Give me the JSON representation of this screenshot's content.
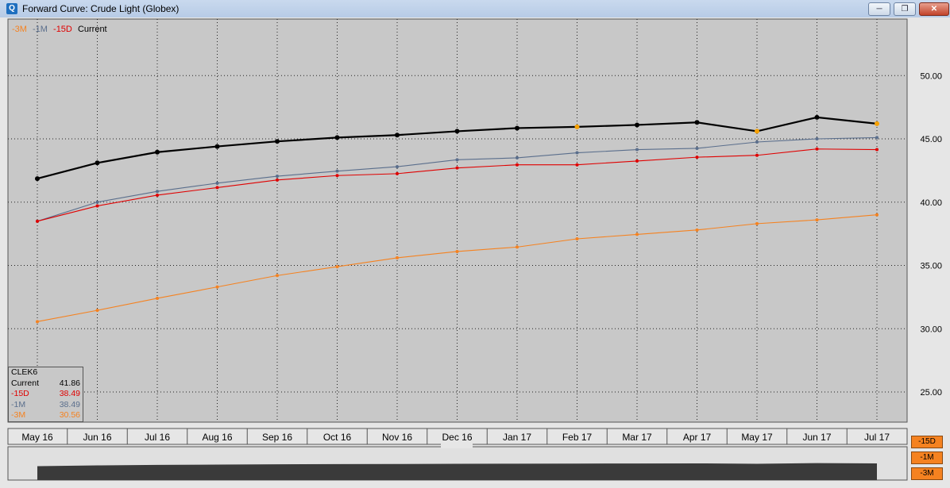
{
  "window": {
    "title": "Forward Curve: Crude Light (Globex)",
    "icon": "q-app-icon"
  },
  "window_buttons": [
    "minimize",
    "restore",
    "close"
  ],
  "legend": [
    {
      "label": "-3M",
      "color": "#f58220"
    },
    {
      "label": "-1M",
      "color": "#5a6e8c"
    },
    {
      "label": "-15D",
      "color": "#e00000"
    },
    {
      "label": "Current",
      "color": "#000000"
    }
  ],
  "info_box": {
    "title": "CLEK6",
    "rows": [
      {
        "label": "Current",
        "value": "41.86",
        "color": "#000000"
      },
      {
        "label": "-15D",
        "value": "38.49",
        "color": "#e00000"
      },
      {
        "label": "-1M",
        "value": "38.49",
        "color": "#5a6e8c"
      },
      {
        "label": "-3M",
        "value": "30.56",
        "color": "#f58220"
      }
    ]
  },
  "side_buttons": [
    "-15D",
    "-1M",
    "-3M"
  ],
  "chart_data": {
    "type": "line",
    "categories": [
      "May 16",
      "Jun 16",
      "Jul 16",
      "Aug 16",
      "Sep 16",
      "Oct 16",
      "Nov 16",
      "Dec 16",
      "Jan 17",
      "Feb 17",
      "Mar 17",
      "Apr 17",
      "May 17",
      "Jun 17",
      "Jul 17"
    ],
    "series": [
      {
        "name": "Current",
        "color": "#000000",
        "values": [
          41.86,
          43.1,
          43.95,
          44.4,
          44.8,
          45.1,
          45.3,
          45.6,
          45.85,
          45.95,
          46.1,
          46.3,
          45.6,
          46.7,
          46.2
        ]
      },
      {
        "name": "-15D",
        "color": "#e00000",
        "values": [
          38.49,
          39.7,
          40.55,
          41.15,
          41.75,
          42.1,
          42.25,
          42.7,
          42.95,
          42.95,
          43.25,
          43.55,
          43.7,
          44.2,
          44.15
        ]
      },
      {
        "name": "-1M",
        "color": "#5a6e8c",
        "values": [
          38.49,
          40.0,
          40.85,
          41.5,
          42.05,
          42.45,
          42.8,
          43.35,
          43.5,
          43.9,
          44.15,
          44.25,
          44.75,
          45.0,
          45.1
        ]
      },
      {
        "name": "-3M",
        "color": "#f58220",
        "values": [
          30.56,
          31.45,
          32.4,
          33.3,
          34.2,
          34.9,
          35.6,
          36.1,
          36.45,
          37.1,
          37.45,
          37.8,
          38.3,
          38.6,
          39.0
        ]
      }
    ],
    "highlight_points": {
      "series": "Current",
      "indices": [
        9,
        12,
        14
      ],
      "color": "#f5a000"
    },
    "yticks": [
      "25.00",
      "30.00",
      "35.00",
      "40.00",
      "45.00",
      "50.00"
    ],
    "ylim": [
      22.5,
      54.0
    ],
    "grid": true,
    "legend_position": "top-left"
  },
  "navigator": {
    "series": "Current"
  }
}
